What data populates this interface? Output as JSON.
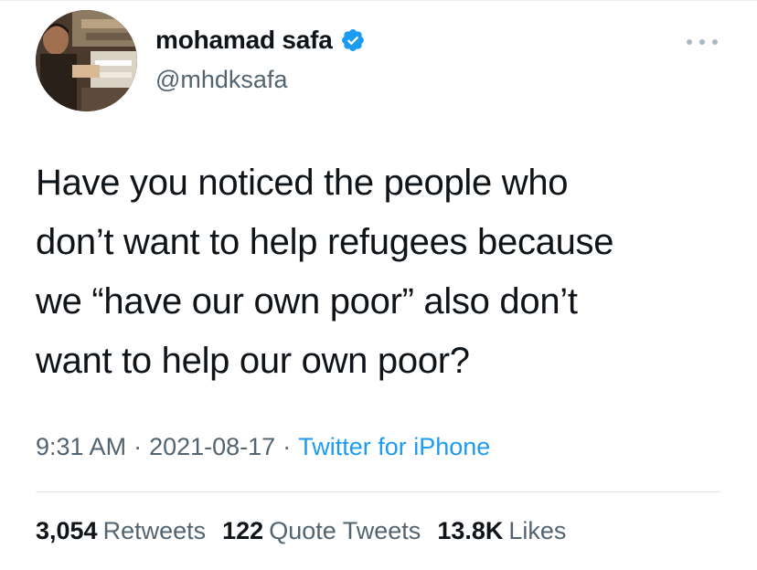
{
  "tweet": {
    "user": {
      "display_name": "mohamad safa",
      "handle": "@mhdksafa",
      "verified": true,
      "verified_color": "#1d9bf0"
    },
    "text_lines": [
      "Have you noticed the people who",
      "don’t want to help refugees because",
      "we “have our own poor” also don’t",
      "want to help our own poor?"
    ],
    "time": "9:31 AM",
    "separator": "·",
    "date": "2021-08-17",
    "source": "Twitter for iPhone",
    "stats": {
      "retweets_count": "3,054",
      "retweets_label": "Retweets",
      "quotes_count": "122",
      "quotes_label": "Quote Tweets",
      "likes_count": "13.8K",
      "likes_label": "Likes"
    },
    "more_icon": "more-horizontal-icon",
    "colors": {
      "text": "#0f1419",
      "secondary": "#536471",
      "link": "#1d9bf0"
    }
  }
}
